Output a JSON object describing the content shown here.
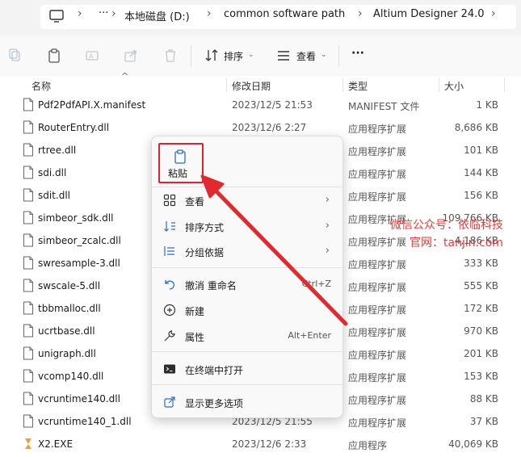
{
  "address": {
    "more": "···",
    "crumbs": [
      "本地磁盘 (D:)",
      "common software path",
      "Altium Designer 24.0"
    ]
  },
  "toolbar": {
    "sort_label": "排序",
    "view_label": "查看",
    "more_label": "···"
  },
  "columns": {
    "name": "名称",
    "date": "修改日期",
    "type": "类型",
    "size": "大小"
  },
  "files": [
    {
      "name": "Pdf2PdfAPI.X.manifest",
      "date": "2023/12/5 21:53",
      "type": "MANIFEST 文件",
      "size": "1 KB"
    },
    {
      "name": "RouterEntry.dll",
      "date": "2023/12/6 2:27",
      "type": "应用程序扩展",
      "size": "8,686 KB"
    },
    {
      "name": "rtree.dll",
      "date": "",
      "type": "应用程序扩展",
      "size": "101 KB"
    },
    {
      "name": "sdi.dll",
      "date": "",
      "type": "应用程序扩展",
      "size": "144 KB"
    },
    {
      "name": "sdit.dll",
      "date": "",
      "type": "应用程序扩展",
      "size": "156 KB"
    },
    {
      "name": "simbeor_sdk.dll",
      "date": "",
      "type": "应用程序扩展",
      "size": "109,766 KB"
    },
    {
      "name": "simbeor_zcalc.dll",
      "date": "",
      "type": "应用程序扩展",
      "size": "4,186 KB"
    },
    {
      "name": "swresample-3.dll",
      "date": "",
      "type": "应用程序扩展",
      "size": "333 KB"
    },
    {
      "name": "swscale-5.dll",
      "date": "",
      "type": "应用程序扩展",
      "size": "555 KB"
    },
    {
      "name": "tbbmalloc.dll",
      "date": "",
      "type": "应用程序扩展",
      "size": "172 KB"
    },
    {
      "name": "ucrtbase.dll",
      "date": "",
      "type": "应用程序扩展",
      "size": "970 KB"
    },
    {
      "name": "unigraph.dll",
      "date": "",
      "type": "应用程序扩展",
      "size": "201 KB"
    },
    {
      "name": "vcomp140.dll",
      "date": "",
      "type": "应用程序扩展",
      "size": "153 KB"
    },
    {
      "name": "vcruntime140.dll",
      "date": "",
      "type": "应用程序扩展",
      "size": "88 KB"
    },
    {
      "name": "vcruntime140_1.dll",
      "date": "2023/12/5 21:55",
      "type": "应用程序扩展",
      "size": "37 KB"
    },
    {
      "name": "X2.EXE",
      "date": "2023/12/6 2:33",
      "type": "应用程序",
      "size": "40,069 KB"
    }
  ],
  "menu": {
    "paste": "粘贴",
    "view": "查看",
    "sort": "排序方式",
    "group": "分组依据",
    "undo": "撤消 重命名",
    "undo_shortcut": "Ctrl+Z",
    "new": "新建",
    "properties": "属性",
    "properties_shortcut": "Alt+Enter",
    "terminal": "在终端中打开",
    "more_options": "显示更多选项"
  },
  "watermark": {
    "line1": "微信公众号：依临科技",
    "line2": "官网：tanjin.com"
  },
  "colors": {
    "highlight_red": "#d9262b",
    "accent_blue": "#2a6fbd"
  }
}
